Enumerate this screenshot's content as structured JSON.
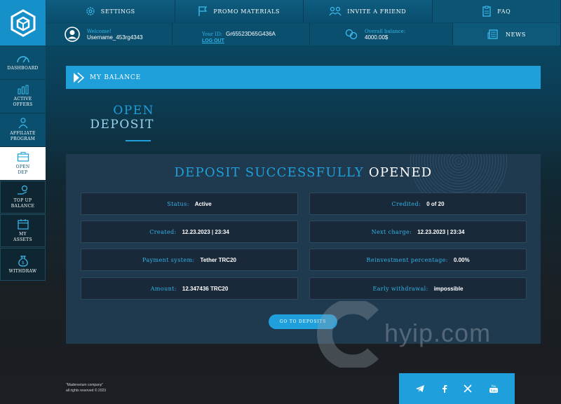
{
  "nav": {
    "settings": "SETTINGS",
    "promo": "PROMO MATERIALS",
    "invite": "INVITE A FRIEND",
    "faq": "FAQ",
    "news": "NEWS"
  },
  "user": {
    "welcome_label": "Welcome!",
    "username": "Username_453rg4343",
    "id_label": "Your ID:",
    "id_value": "Gr65523D65G436A",
    "logout": "LOG OUT",
    "balance_label": "Overall balance:",
    "balance_value": "4000.00$"
  },
  "sidebar": {
    "items": [
      {
        "label": "DASHBOARD",
        "icon": "speedometer-icon"
      },
      {
        "label": "ACTIVE OFFERS",
        "icon": "chart-icon"
      },
      {
        "label": "AFFILIATE PROGRAM",
        "icon": "people-icon"
      },
      {
        "label": "OPEN DEP",
        "icon": "briefcase-icon"
      },
      {
        "label": "TOP UP BALANCE",
        "icon": "wallet-hand-icon"
      },
      {
        "label": "MY ASSETS",
        "icon": "calendar-icon"
      },
      {
        "label": "WITHDRAW",
        "icon": "money-bag-icon"
      }
    ]
  },
  "section": {
    "title": "MY BALANCE",
    "open_line1": "OPEN",
    "open_line2": "DEPOSIT"
  },
  "panel": {
    "title_blue": "DEPOSIT SUCCESSFULLY",
    "title_white": "OPENED",
    "fields": {
      "status_k": "Status:",
      "status_v": "Active",
      "credited_k": "Credited:",
      "credited_v": "0 of 20",
      "created_k": "Created:",
      "created_v": "12.23.2023 | 23:34",
      "next_k": "Next charge:",
      "next_v": "12.23.2023 | 23:34",
      "pay_k": "Payment system:",
      "pay_v": "Tether TRC20",
      "reinv_k": "Reinvestment percentage:",
      "reinv_v": "0.00%",
      "amount_k": "Amount:",
      "amount_v": "12.347436 TRC20",
      "early_k": "Early withdrawal:",
      "early_v": "impossible"
    },
    "button": "GO TO DEPOSITS"
  },
  "watermark": "hyip.com",
  "footer": {
    "company": "\"Madenerium company\"",
    "rights": "all rights reserved © 2023",
    "social": [
      "telegram-icon",
      "facebook-icon",
      "x-icon",
      "youtube-icon"
    ]
  },
  "colors": {
    "accent": "#1fa0db",
    "panel": "#1f3a4f",
    "field": "#19293a"
  }
}
